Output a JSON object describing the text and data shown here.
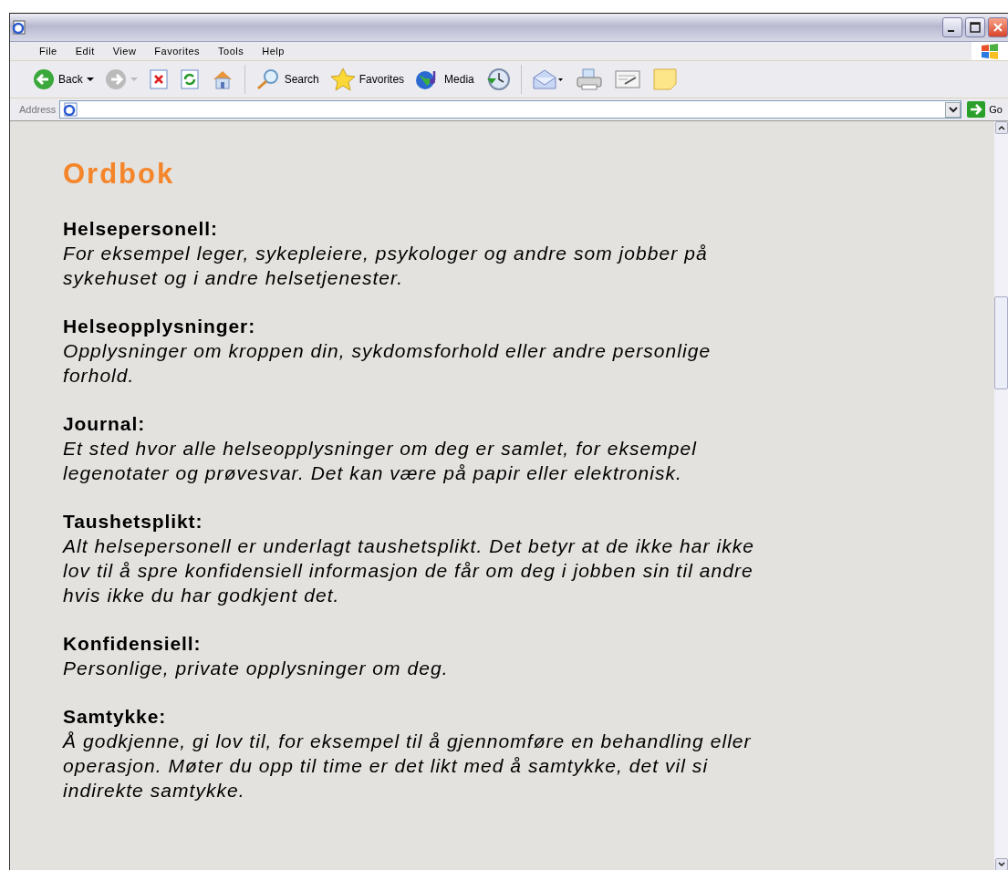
{
  "menu": [
    "File",
    "Edit",
    "View",
    "Favorites",
    "Tools",
    "Help"
  ],
  "toolbar": [
    {
      "kind": "back",
      "label": "Back",
      "disabled": false
    },
    {
      "kind": "forward",
      "disabled": true
    },
    {
      "kind": "stop"
    },
    {
      "kind": "refresh"
    },
    {
      "kind": "home"
    },
    {
      "kind": "search",
      "label": "Search"
    },
    {
      "kind": "favorites",
      "label": "Favorites"
    },
    {
      "kind": "media",
      "label": "Media"
    },
    {
      "kind": "history"
    },
    {
      "kind": "mail"
    },
    {
      "kind": "print"
    },
    {
      "kind": "edit"
    },
    {
      "kind": "note"
    }
  ],
  "address": {
    "label": "Address",
    "go": "Go"
  },
  "page": {
    "title": "Ordbok",
    "entries": [
      {
        "term": "Helsepersonell:",
        "definition": "For eksempel leger, sykepleiere, psykologer og andre som jobber på sykehuset og i andre helsetjenester."
      },
      {
        "term": "Helseopplysninger:",
        "definition": "Opplysninger om kroppen din, sykdomsforhold eller andre personlige forhold."
      },
      {
        "term": "Journal:",
        "definition": "Et sted hvor alle helseopplysninger om deg er samlet, for eksempel legenotater og prøvesvar. Det kan være på papir eller elektronisk."
      },
      {
        "term": "Taushetsplikt:",
        "definition": "Alt helsepersonell er underlagt taushetsplikt. Det betyr at de ikke har ikke lov til å spre konfidensiell informasjon de får om deg i jobben sin til andre hvis ikke du har godkjent det."
      },
      {
        "term": "Konfidensiell:",
        "definition": "Personlige, private opplysninger om deg."
      },
      {
        "term": "Samtykke:",
        "definition": "Å godkjenne, gi lov til, for eksempel til å gjennomføre en behandling eller operasjon. Møter du opp til time er det likt med å samtykke, det vil si indirekte samtykke."
      }
    ]
  }
}
